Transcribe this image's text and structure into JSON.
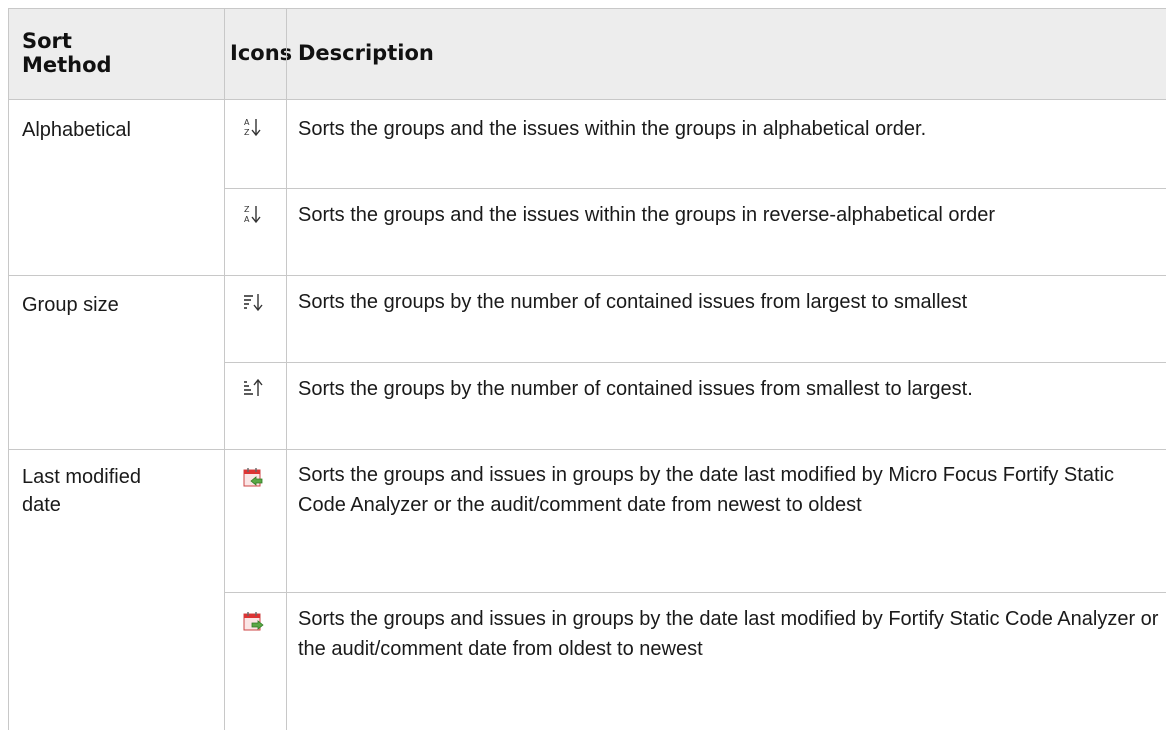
{
  "table": {
    "headers": {
      "sort_method": "Sort\nMethod",
      "icons": "Icons",
      "description": "Description"
    },
    "rows": [
      {
        "method": "Alphabetical",
        "icon": "sort-a-z-icon",
        "description": "Sorts the groups and the issues within the groups in alphabetical order."
      },
      {
        "method": "",
        "icon": "sort-z-a-icon",
        "description": "Sorts the groups and the issues within the groups in reverse-alphabetical order"
      },
      {
        "method": "Group size",
        "icon": "sort-size-descending-icon",
        "description": "Sorts the groups by the number of contained issues from largest to smallest"
      },
      {
        "method": "",
        "icon": "sort-size-ascending-icon",
        "description": "Sorts the groups by the number of contained issues from smallest to largest."
      },
      {
        "method": "Last modified date",
        "icon": "calendar-newest-first-icon",
        "description": "Sorts the groups and issues in groups by the date last modified by Micro Focus Fortify Static Code Analyzer or the audit/comment date from newest to oldest"
      },
      {
        "method": "",
        "icon": "calendar-oldest-first-icon",
        "description": "Sorts the groups and issues in groups by the date last modified by Fortify Static Code Analyzer or the audit/comment date from oldest to newest"
      }
    ]
  }
}
